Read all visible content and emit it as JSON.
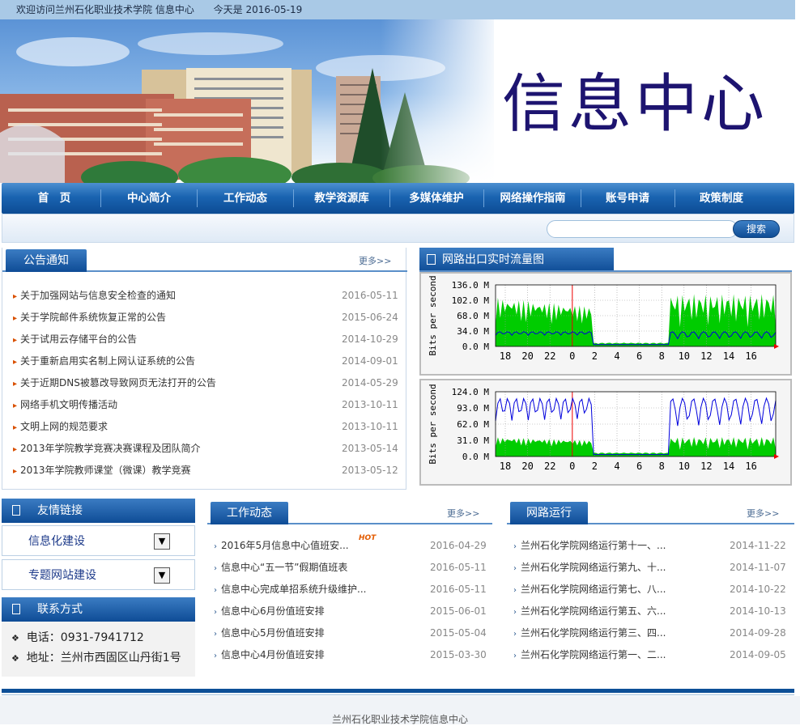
{
  "topbar": {
    "welcome": "欢迎访问兰州石化职业技术学院 信息中心",
    "today": "今天是 2016-05-19"
  },
  "banner": {
    "title": "信息中心"
  },
  "nav": {
    "items": [
      "首　页",
      "中心简介",
      "工作动态",
      "教学资源库",
      "多媒体维护",
      "网络操作指南",
      "账号申请",
      "政策制度"
    ]
  },
  "search": {
    "value": "",
    "button": "搜索"
  },
  "notice": {
    "title": "公告通知",
    "more": "更多>>",
    "items": [
      {
        "text": "关于加强网站与信息安全检查的通知",
        "date": "2016-05-11"
      },
      {
        "text": "关于学院邮件系统恢复正常的公告",
        "date": "2015-06-24"
      },
      {
        "text": "关于试用云存储平台的公告",
        "date": "2014-10-29"
      },
      {
        "text": "关于重新启用实名制上网认证系统的公告",
        "date": "2014-09-01"
      },
      {
        "text": "关于近期DNS被篡改导致网页无法打开的公告",
        "date": "2014-05-29"
      },
      {
        "text": "网络手机文明传播活动",
        "date": "2013-10-11"
      },
      {
        "text": "文明上网的规范要求",
        "date": "2013-10-11"
      },
      {
        "text": "2013年学院教学竞赛决赛课程及团队简介",
        "date": "2013-05-14"
      },
      {
        "text": "2013年学院教师课堂（微课）教学竞赛",
        "date": "2013-05-12"
      }
    ]
  },
  "traffic": {
    "title": "网路出口实时流量图",
    "graph1": {
      "ylabel": "Bits per second",
      "yticks": [
        "136.0 M",
        "102.0 M",
        "68.0 M",
        "34.0 M",
        "0.0 M"
      ],
      "xticks": [
        "18",
        "20",
        "22",
        "0",
        "2",
        "4",
        "6",
        "8",
        "10",
        "12",
        "14",
        "16"
      ]
    },
    "graph2": {
      "ylabel": "Bits per second",
      "yticks": [
        "124.0 M",
        "93.0 M",
        "62.0 M",
        "31.0 M",
        "0.0 M"
      ],
      "xticks": [
        "18",
        "20",
        "22",
        "0",
        "2",
        "4",
        "6",
        "8",
        "10",
        "12",
        "14",
        "16"
      ]
    }
  },
  "links": {
    "title": "友情链接",
    "select1": "信息化建设",
    "select2": "专题网站建设"
  },
  "contact": {
    "title": "联系方式",
    "phone": "电话：0931-7941712",
    "address": "地址：兰州市西固区山丹街1号"
  },
  "work": {
    "title": "工作动态",
    "more": "更多>>",
    "hot": "HOT",
    "items": [
      {
        "text": "2016年5月信息中心值班安...",
        "date": "2016-04-29"
      },
      {
        "text": "信息中心“五一节”假期值班表",
        "date": "2016-05-11"
      },
      {
        "text": "信息中心完成单招系统升级维护...",
        "date": "2016-05-11"
      },
      {
        "text": "信息中心6月份值班安排",
        "date": "2015-06-01"
      },
      {
        "text": "信息中心5月份值班安排",
        "date": "2015-05-04"
      },
      {
        "text": "信息中心4月份值班安排",
        "date": "2015-03-30"
      }
    ]
  },
  "network": {
    "title": "网路运行",
    "more": "更多>>",
    "items": [
      {
        "text": "兰州石化学院网络运行第十一、...",
        "date": "2014-11-22"
      },
      {
        "text": "兰州石化学院网络运行第九、十...",
        "date": "2014-11-07"
      },
      {
        "text": "兰州石化学院网络运行第七、八...",
        "date": "2014-10-22"
      },
      {
        "text": "兰州石化学院网络运行第五、六...",
        "date": "2014-10-13"
      },
      {
        "text": "兰州石化学院网络运行第三、四...",
        "date": "2014-09-28"
      },
      {
        "text": "兰州石化学院网络运行第一、二...",
        "date": "2014-09-05"
      }
    ]
  },
  "footer": {
    "text": "兰州石化职业技术学院信息中心"
  }
}
